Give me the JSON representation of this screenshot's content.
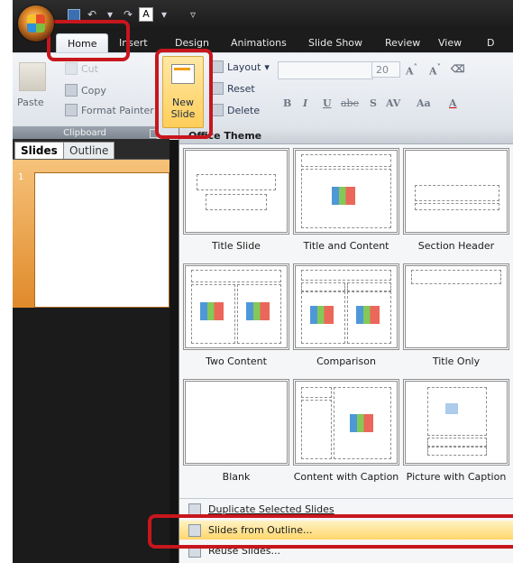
{
  "qat": {
    "a_label": "A"
  },
  "tabs": [
    {
      "label": "Home"
    },
    {
      "label": "Insert"
    },
    {
      "label": "Design"
    },
    {
      "label": "Animations"
    },
    {
      "label": "Slide Show"
    },
    {
      "label": "Review"
    },
    {
      "label": "View"
    },
    {
      "label": "D"
    }
  ],
  "clipboard": {
    "paste": "Paste",
    "cut": "Cut",
    "copy": "Copy",
    "format_painter": "Format Painter",
    "group_label": "Clipboard"
  },
  "slides_group": {
    "new_slide": "New Slide",
    "layout": "Layout",
    "reset": "Reset",
    "delete": "Delete"
  },
  "font_group": {
    "size": "20",
    "bold": "B",
    "italic": "I",
    "underline": "U",
    "strike": "abe",
    "shadow": "S",
    "spacing": "AV",
    "case": "Aa",
    "color": "A"
  },
  "pane": {
    "tab_slides": "Slides",
    "tab_outline": "Outline",
    "slide_num": "1"
  },
  "gallery": {
    "header": "Office Theme",
    "layouts": [
      {
        "name": "Title Slide"
      },
      {
        "name": "Title and Content"
      },
      {
        "name": "Section Header"
      },
      {
        "name": "Two Content"
      },
      {
        "name": "Comparison"
      },
      {
        "name": "Title Only"
      },
      {
        "name": "Blank"
      },
      {
        "name": "Content with Caption"
      },
      {
        "name": "Picture with Caption"
      }
    ],
    "menu": [
      {
        "label": "Duplicate Selected Slides"
      },
      {
        "label": "Slides from Outline..."
      },
      {
        "label": "Reuse Slides..."
      }
    ]
  },
  "colors": {
    "highlight": "#c8161d",
    "hover": "#ffd66b",
    "accent_orange": "#e08a2a"
  }
}
